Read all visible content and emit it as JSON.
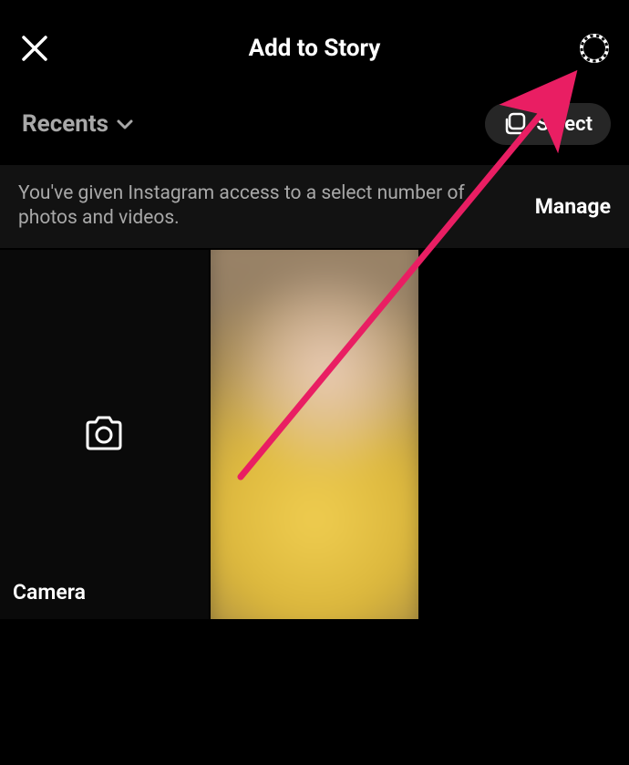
{
  "header": {
    "title": "Add to Story"
  },
  "subheader": {
    "recents_label": "Recents",
    "select_label": "Select"
  },
  "permission": {
    "text": "You've given Instagram access to a select number of photos and videos.",
    "manage_label": "Manage"
  },
  "tiles": {
    "camera_label": "Camera"
  },
  "colors": {
    "arrow": "#e91e63"
  }
}
